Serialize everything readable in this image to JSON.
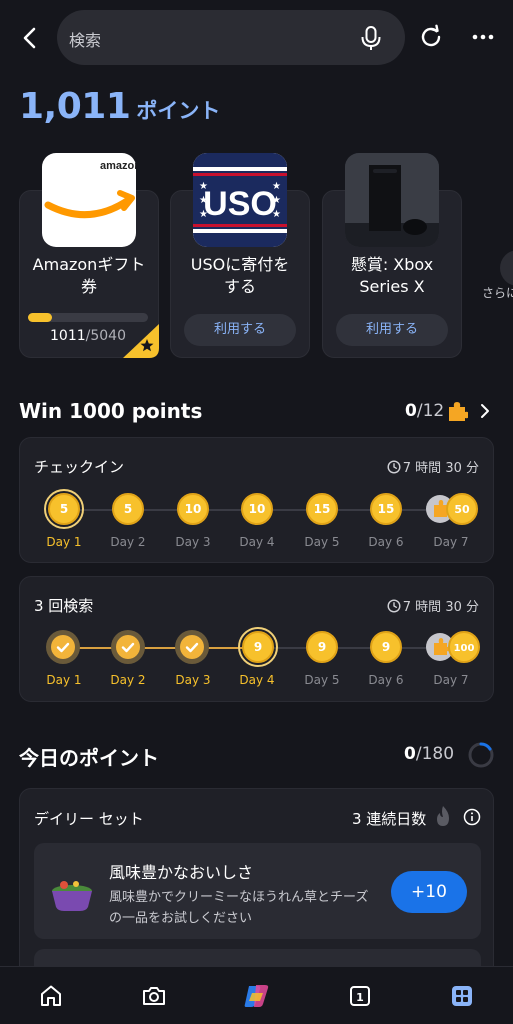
{
  "topbar": {
    "search_placeholder": "検索",
    "icons": [
      "back-arrow-icon",
      "microphone-icon",
      "refresh-icon",
      "more-icon"
    ]
  },
  "points": {
    "value": "1,011",
    "unit": "ポイント"
  },
  "rewards": [
    {
      "title_line1": "Amazonギフト",
      "title_line2": "券",
      "progress_current": "1011",
      "progress_total": "/5040",
      "progress_fraction": 0.2,
      "image": "amazon-gift-logo"
    },
    {
      "title_line1": "USOに寄付を",
      "title_line2": "する",
      "button": "利用する",
      "image": "uso-logo",
      "logo_text": "USO"
    },
    {
      "title_line1": "懸賞: Xbox",
      "title_line2": "Series X",
      "button": "利用する",
      "image": "xbox-series-x"
    }
  ],
  "more_rewards_label": "さらに",
  "win": {
    "title": "Win 1000 points",
    "count": "0",
    "total": "/12"
  },
  "checkin": {
    "title": "チェックイン",
    "time": "7 時間 30 分",
    "coins": [
      "5",
      "5",
      "10",
      "10",
      "15",
      "15"
    ],
    "bonus": "50",
    "days": [
      "Day 1",
      "Day 2",
      "Day 3",
      "Day 4",
      "Day 5",
      "Day 6",
      "Day 7"
    ]
  },
  "search3": {
    "title": "3 回検索",
    "time": "7 時間 30 分",
    "coins": [
      "",
      "",
      "",
      "9",
      "9",
      "9"
    ],
    "bonus": "100",
    "days": [
      "Day 1",
      "Day 2",
      "Day 3",
      "Day 4",
      "Day 5",
      "Day 6",
      "Day 7"
    ]
  },
  "today": {
    "title": "今日のポイント",
    "count": "0",
    "total": "/180"
  },
  "daily": {
    "title": "デイリー セット",
    "streak": "3 連続日数",
    "offer_title": "風味豊かなおいしさ",
    "offer_desc": "風味豊かでクリーミーなほうれん草とチーズの一品をお試しください",
    "offer_button": "+10"
  },
  "colors": {
    "accent": "#8ab4f8",
    "gold": "#f7c12c",
    "button_blue": "#1a73e8",
    "background": "#15161c"
  }
}
